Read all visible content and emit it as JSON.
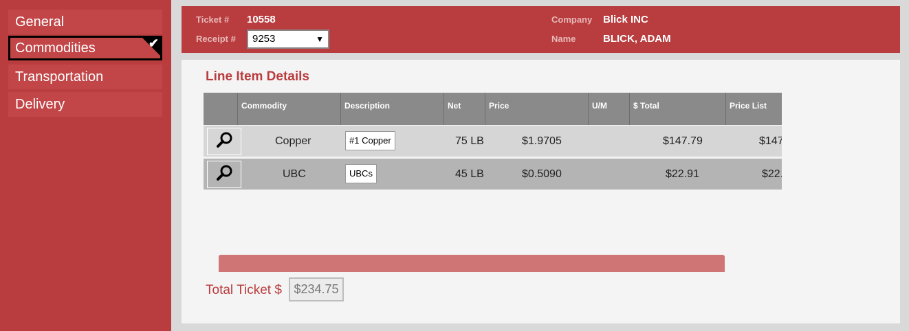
{
  "sidebar": {
    "items": [
      {
        "label": "General"
      },
      {
        "label": "Commodities",
        "active": true
      },
      {
        "label": "Transportation"
      },
      {
        "label": "Delivery"
      }
    ]
  },
  "header": {
    "ticket_label": "Ticket #",
    "ticket_value": "10558",
    "receipt_label": "Receipt #",
    "receipt_value": "9253",
    "company_label": "Company",
    "company_value": "Blick INC",
    "name_label": "Name",
    "name_value": "BLICK, ADAM"
  },
  "main": {
    "section_title": "Line Item Details",
    "columns": [
      "Commodity",
      "Description",
      "Net",
      "Price",
      "U/M",
      "$ Total",
      "Price List"
    ],
    "rows": [
      {
        "commodity": "Copper",
        "description": "#1 Copper",
        "net": "75 LB",
        "price": "$1.9705",
        "um": "",
        "total": "$147.79",
        "price_list": "$147"
      },
      {
        "commodity": "UBC",
        "description": "UBCs",
        "net": "45 LB",
        "price": "$0.5090",
        "um": "",
        "total": "$22.91",
        "price_list": "$22."
      }
    ],
    "total_label": "Total Ticket $",
    "total_value": "$234.75"
  },
  "colors": {
    "brand_red": "#b93c3e",
    "header_gray": "#8a8a8a",
    "progress": "#d07575"
  },
  "icons": {
    "search": "search-icon",
    "check": "checkmark-icon"
  }
}
